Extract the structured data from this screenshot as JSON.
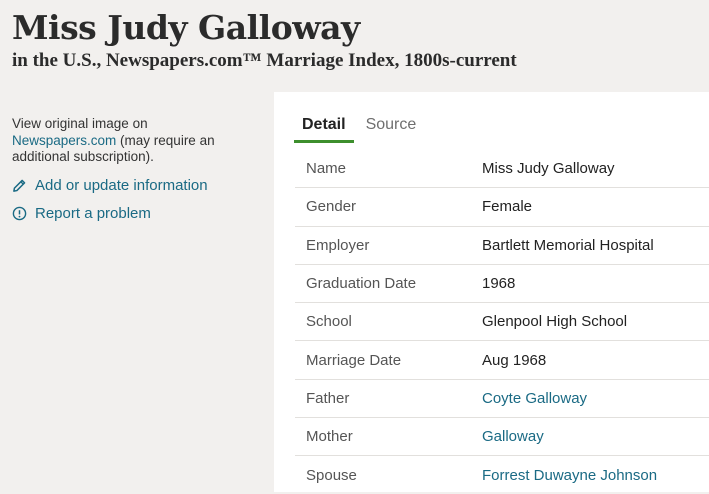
{
  "record": {
    "name": "Miss Judy Galloway",
    "collection": "in the U.S., Newspapers.com™ Marriage Index, 1800s-current"
  },
  "sidebar": {
    "view_prefix": "View original image on",
    "view_link": "Newspapers.com",
    "view_suffix": " (may require an additional subscription).",
    "add_label": "Add or update information",
    "report_label": "Report a problem"
  },
  "tabs": [
    {
      "label": "Detail",
      "active": true
    },
    {
      "label": "Source",
      "active": false
    }
  ],
  "details": [
    {
      "label": "Name",
      "value": "Miss Judy Galloway",
      "link": false
    },
    {
      "label": "Gender",
      "value": "Female",
      "link": false
    },
    {
      "label": "Employer",
      "value": "Bartlett Memorial Hospital",
      "link": false
    },
    {
      "label": "Graduation Date",
      "value": "1968",
      "link": false
    },
    {
      "label": "School",
      "value": "Glenpool High School",
      "link": false
    },
    {
      "label": "Marriage Date",
      "value": "Aug 1968",
      "link": false
    },
    {
      "label": "Father",
      "value": "Coyte Galloway",
      "link": true
    },
    {
      "label": "Mother",
      "value": "Galloway",
      "link": true
    },
    {
      "label": "Spouse",
      "value": "Forrest Duwayne Johnson",
      "link": true
    }
  ],
  "colors": {
    "background": "#f2f0ee",
    "link": "#1a6a84",
    "active_tab_underline": "#3d8f2d"
  },
  "icons": {
    "add": "pencil-icon",
    "report": "info-circle-icon"
  }
}
